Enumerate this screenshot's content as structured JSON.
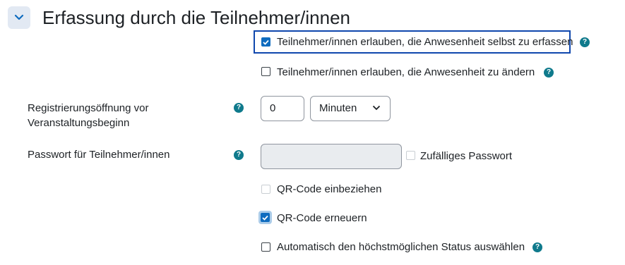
{
  "section": {
    "title": "Erfassung durch die Teilnehmer/innen",
    "collapse_icon": "chevron-down-icon"
  },
  "options": {
    "self_record": {
      "label": "Teilnehmer/innen erlauben, die Anwesenheit selbst zu erfassen",
      "checked": true
    },
    "allow_change": {
      "label": "Teilnehmer/innen erlauben, die Anwesenheit zu ändern",
      "checked": false
    },
    "random_password": {
      "label": "Zufälliges Passwort",
      "checked": false
    },
    "include_qr": {
      "label": "QR-Code einbeziehen",
      "checked": false,
      "disabled": true
    },
    "rotate_qr": {
      "label": "QR-Code erneuern",
      "checked": true
    },
    "auto_status": {
      "label": "Automatisch den höchstmöglichen Status auswählen",
      "checked": false
    }
  },
  "registration": {
    "label_line1": "Registrierungsöffnung vor",
    "label_line2": "Veranstaltungsbeginn",
    "value": "0",
    "unit_selected": "Minuten"
  },
  "password": {
    "label": "Passwort für Teilnehmer/innen",
    "value": ""
  },
  "help_icon_text": "?",
  "colors": {
    "accent": "#0f6cbf",
    "help": "#0f7a8c",
    "focus": "#0f47ad"
  }
}
